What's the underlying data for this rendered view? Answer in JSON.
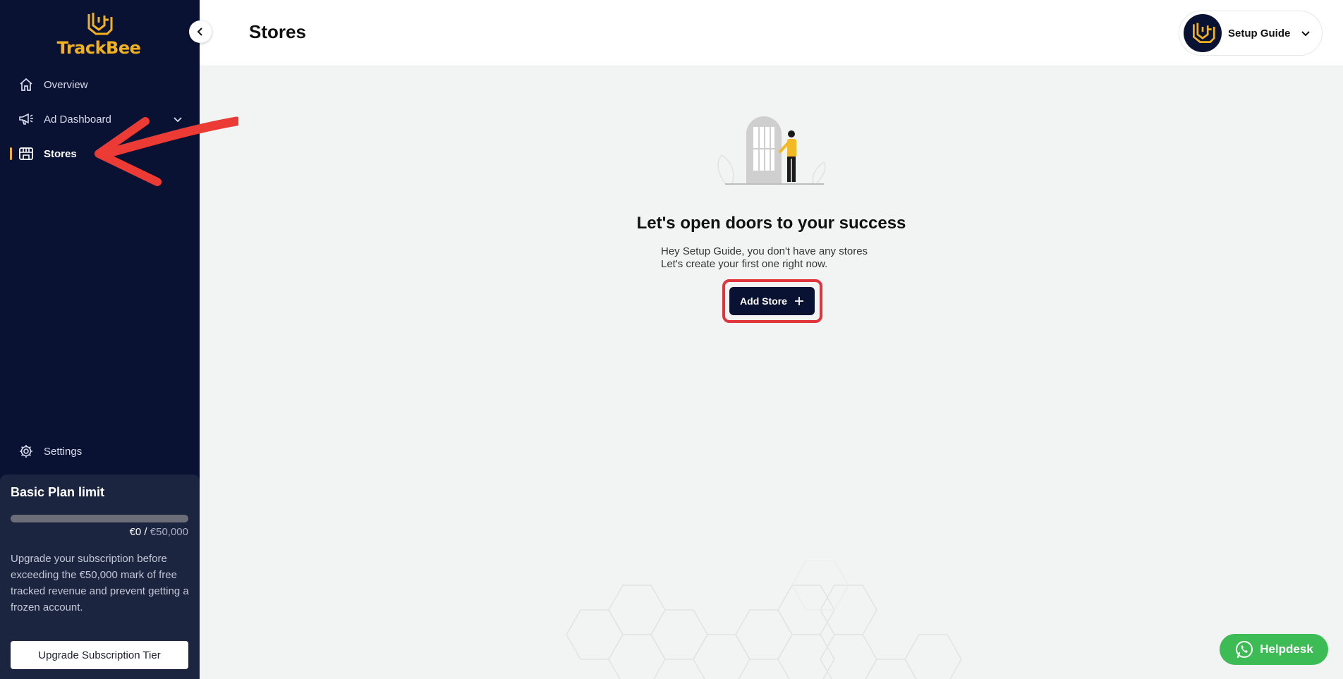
{
  "app": {
    "brand": "TrackBee"
  },
  "sidebar": {
    "items": [
      {
        "label": "Overview",
        "icon": "home-icon"
      },
      {
        "label": "Ad Dashboard",
        "icon": "megaphone-icon",
        "has_chevron": true
      },
      {
        "label": "Stores",
        "icon": "store-icon",
        "active": true
      },
      {
        "label": "Settings",
        "icon": "gear-icon"
      }
    ],
    "plan": {
      "title": "Basic Plan limit",
      "used": "€0",
      "separator": " / ",
      "limit": "€50,000",
      "progress": 0,
      "description": "Upgrade your subscription before exceeding the €50,000 mark of free tracked revenue and prevent getting a frozen account.",
      "upgrade_label": "Upgrade Subscription Tier"
    }
  },
  "header": {
    "title": "Stores",
    "user_name": "Setup Guide"
  },
  "main": {
    "empty_title": "Let's open doors to your success",
    "empty_line1": "Hey Setup Guide, you don't have any stores",
    "empty_line2": "Let's create your first one right now.",
    "add_store_label": "Add Store"
  },
  "helpdesk": {
    "label": "Helpdesk"
  },
  "colors": {
    "sidebar_bg": "#0a1233",
    "accent": "#f2b21c",
    "highlight": "#e0353d",
    "helpdesk": "#3dbb55"
  }
}
